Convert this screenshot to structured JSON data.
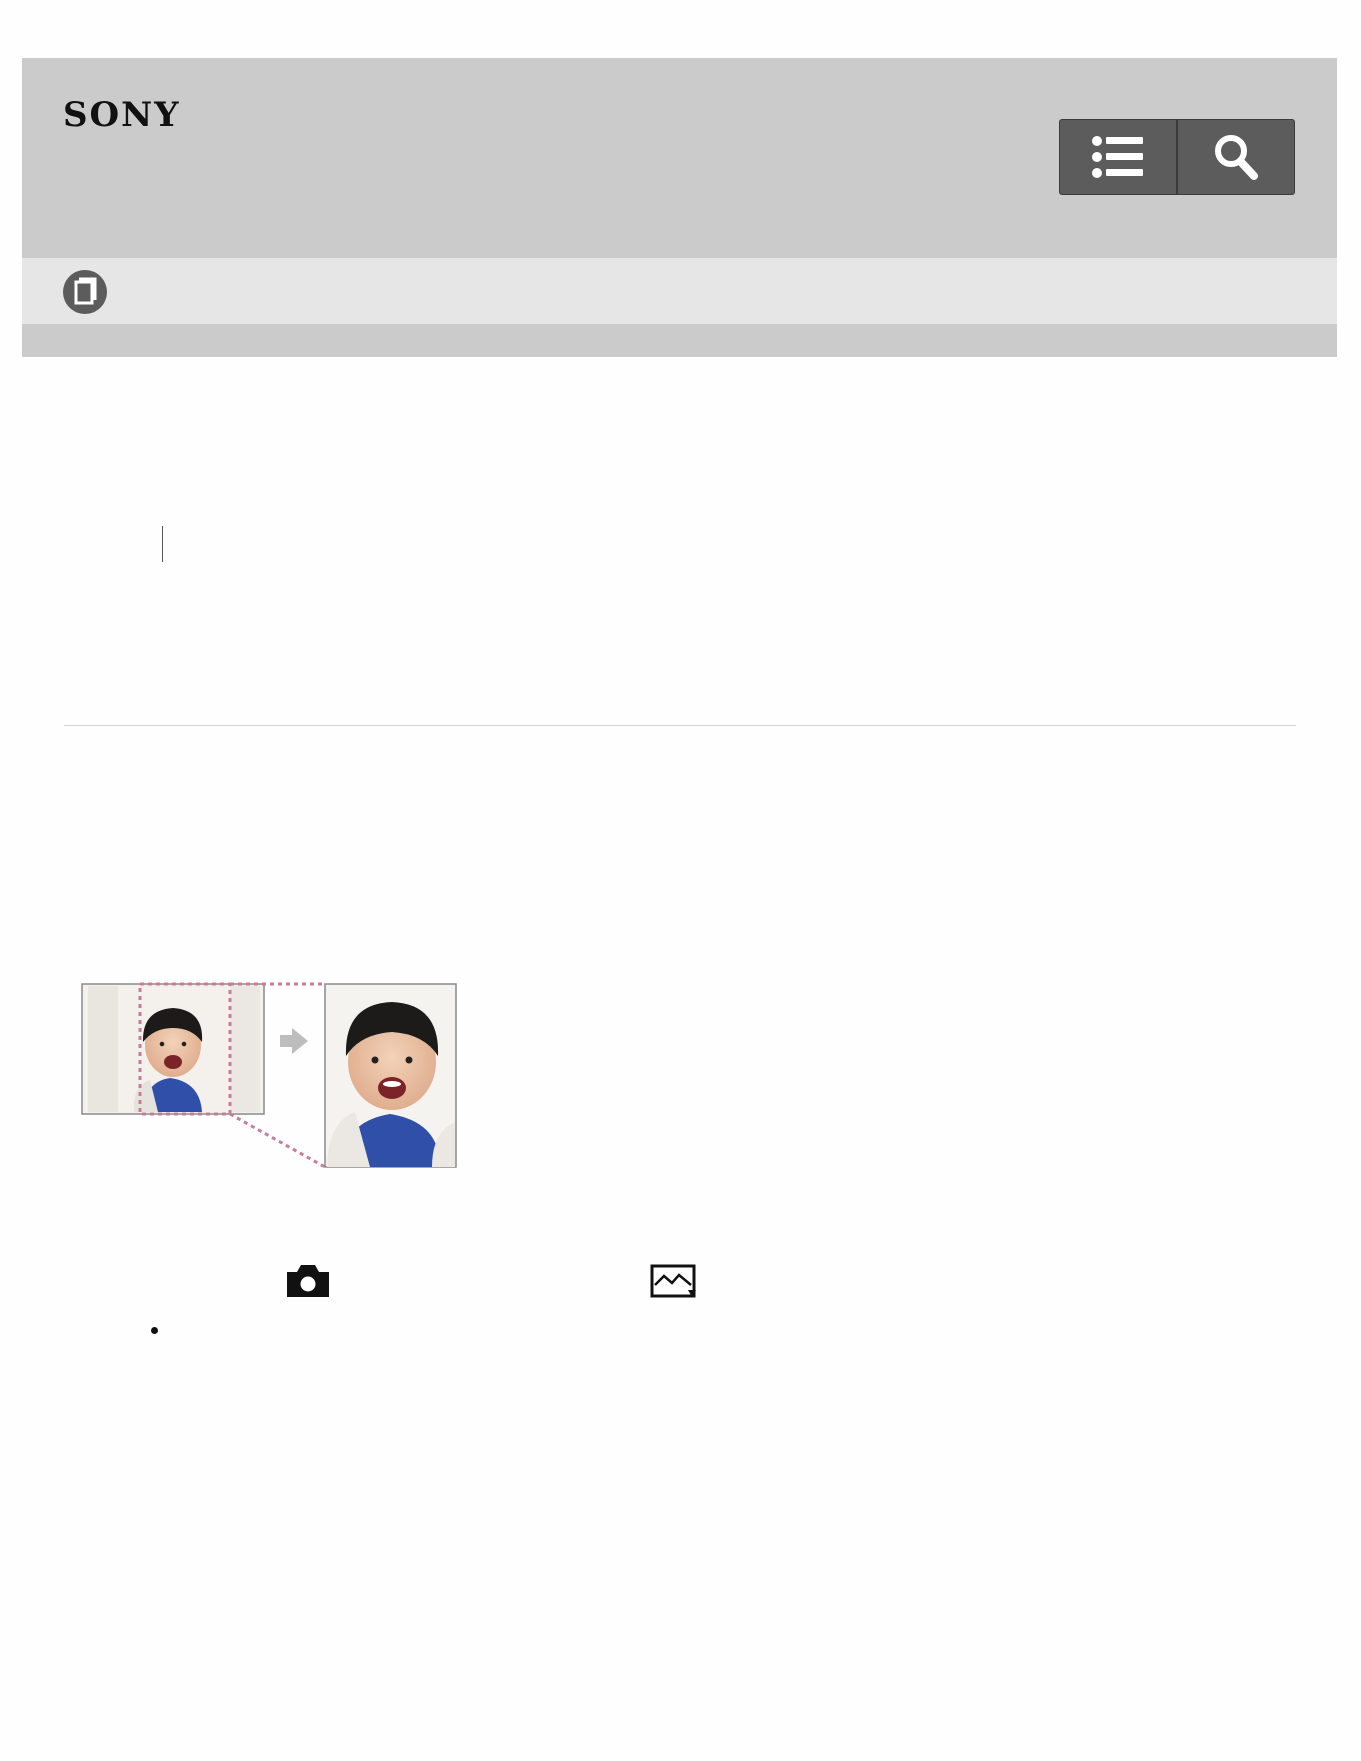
{
  "header": {
    "brand": "SONY",
    "buttons": [
      {
        "icon": "list-icon"
      },
      {
        "icon": "search-icon"
      }
    ]
  },
  "subheader": {
    "icon": "book-icon"
  },
  "colors": {
    "header_bg": "#cbcbcb",
    "subheader_bg": "#e6e6e6",
    "button_bg": "#5c5c5c",
    "crop_marker": "#c77d9b"
  },
  "content": {
    "illustration": "crop-illustration",
    "icons": [
      "camera-icon",
      "playback-icon"
    ]
  }
}
